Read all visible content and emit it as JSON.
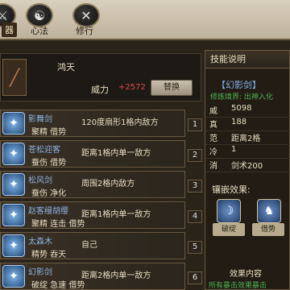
{
  "tabs": [
    {
      "label": "器",
      "icon": "sword-icon",
      "active": true
    },
    {
      "label": "心法",
      "icon": "yinyang-icon",
      "active": false
    },
    {
      "label": "修行",
      "icon": "crossed-swords-icon",
      "active": false
    }
  ],
  "weapon": {
    "name": "鸿天",
    "power_label": "威力",
    "power_value": "+2572",
    "replace_label": "替换"
  },
  "skills": [
    {
      "name": "影舞剑",
      "tags": "聚精 借势",
      "desc": "120度扇形1格内敌方",
      "num": "1"
    },
    {
      "name": "苍松迎客",
      "tags": "蚕伤 借势",
      "desc": "距离1格内单一敌方",
      "num": "2"
    },
    {
      "name": "松风剑",
      "tags": "蚕伤 净化",
      "desc": "周围2格内敌方",
      "num": "3"
    },
    {
      "name": "赵客缦胡缨",
      "tags": "聚精 连击 借势",
      "desc": "距离1格内单一敌方",
      "num": "4"
    },
    {
      "name": "太森木",
      "tags": "精势 吞天",
      "desc": "自己",
      "num": "5"
    },
    {
      "name": "幻影剑",
      "tags": "破绽 急速 借势",
      "desc": "距离2格内单一敌方",
      "num": "6"
    }
  ],
  "detail": {
    "header": "技能说明",
    "title": "【幻影剑】",
    "realm": "修炼境界: 出神入化",
    "stats": [
      {
        "k": "威",
        "v": "5098"
      },
      {
        "k": "真",
        "v": "188"
      },
      {
        "k": "范",
        "v": "距离2格"
      },
      {
        "k": "冷",
        "v": "1"
      },
      {
        "k": "消",
        "v": "剑术200"
      }
    ],
    "effects_label": "镶嵌效果:",
    "effects": [
      {
        "label": "破绽",
        "icon": "crescent-icon"
      },
      {
        "label": "借势",
        "icon": "figure-icon"
      }
    ],
    "effect_content_title": "效果内容",
    "effect_content_text": "所有暴击效果暴击"
  }
}
